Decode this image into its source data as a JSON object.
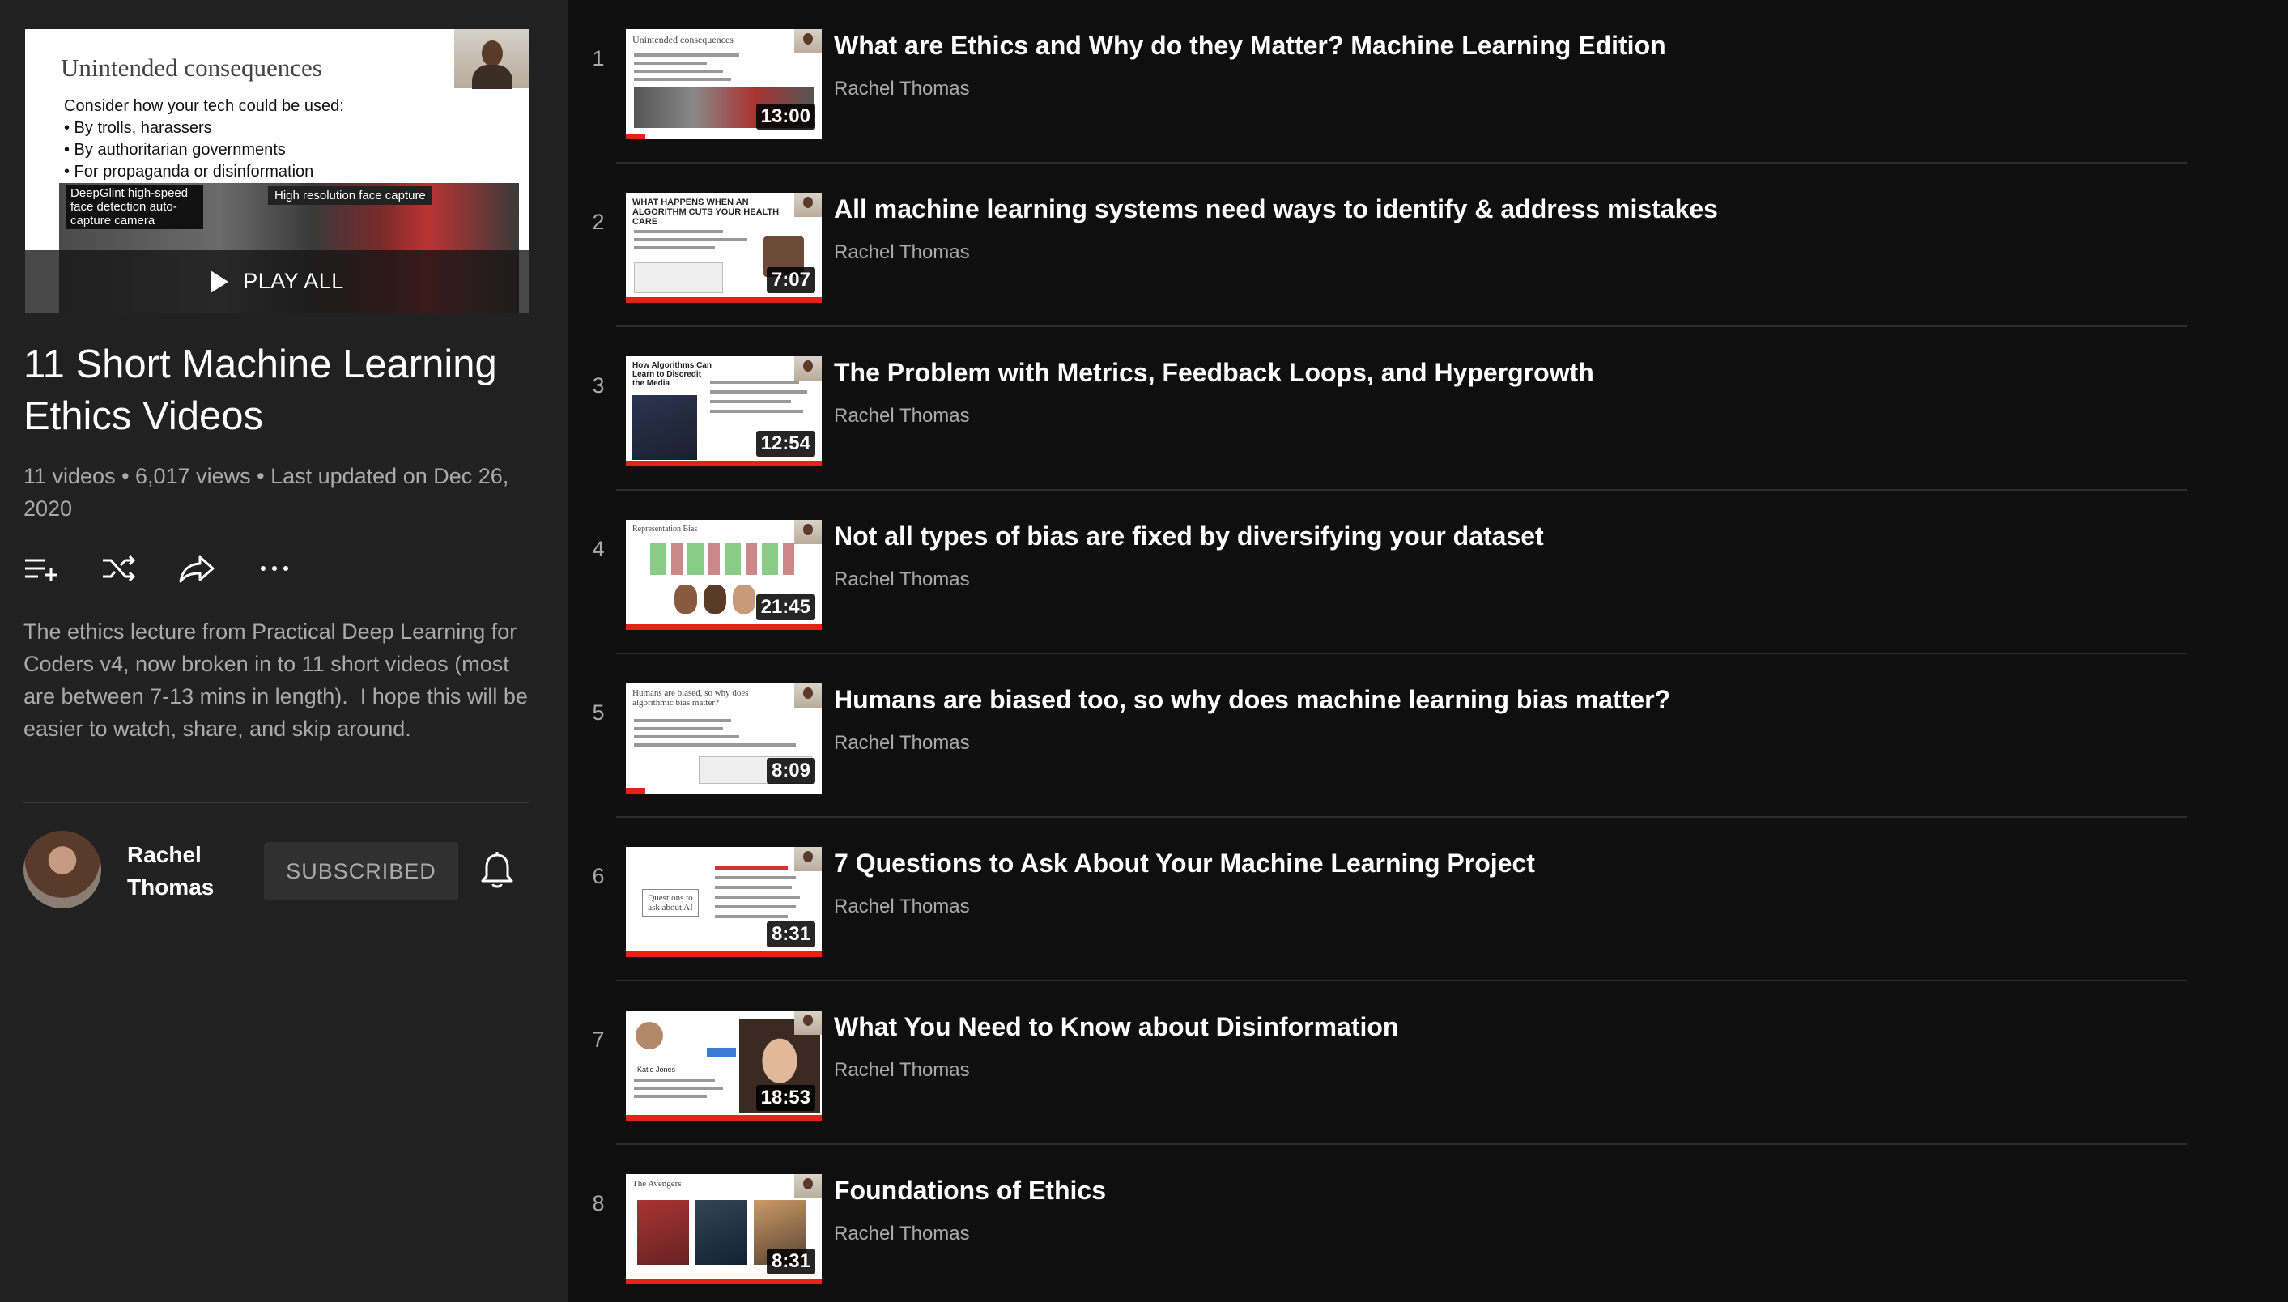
{
  "sidebar": {
    "hero_slide": {
      "title": "Unintended consequences",
      "lines": [
        "Consider how your tech could be used:",
        "• By trolls, harassers",
        "• By authoritarian governments",
        "• For propaganda or disinformation"
      ],
      "caption_left": "DeepGlint high-speed face detection auto-capture camera",
      "caption_right": "High resolution face capture"
    },
    "play_all_label": "PLAY ALL",
    "playlist_title": "11 Short Machine Learning Ethics Videos",
    "stats": "11 videos • 6,017 views • Last updated on Dec 26, 2020",
    "description": "The ethics lecture from Practical Deep Learning for Coders v4, now broken in to 11 short videos (most are between 7-13 mins in length).  I hope this will be easier to watch, share, and skip around.",
    "actions": [
      "add-to-queue-icon",
      "shuffle-icon",
      "share-icon",
      "more-icon"
    ],
    "channel_name": "Rachel Thomas",
    "subscribe_label": "SUBSCRIBED"
  },
  "videos": [
    {
      "index": "1",
      "title": "What are Ethics and Why do they Matter? Machine Learning Edition",
      "author": "Rachel Thomas",
      "duration": "13:00",
      "thumb_text": "Unintended consequences",
      "progress": 0.1
    },
    {
      "index": "2",
      "title": "All machine learning systems need ways to identify & address mistakes",
      "author": "Rachel Thomas",
      "duration": "7:07",
      "thumb_text": "WHAT HAPPENS WHEN AN ALGORITHM CUTS YOUR HEALTH CARE",
      "progress": 1.0
    },
    {
      "index": "3",
      "title": "The Problem with Metrics, Feedback Loops, and Hypergrowth",
      "author": "Rachel Thomas",
      "duration": "12:54",
      "thumb_text": "How Algorithms Can Learn to Discredit the Media",
      "progress": 1.0
    },
    {
      "index": "4",
      "title": "Not all types of bias are fixed by diversifying your dataset",
      "author": "Rachel Thomas",
      "duration": "21:45",
      "thumb_text": "Representation Bias",
      "progress": 1.0
    },
    {
      "index": "5",
      "title": "Humans are biased too, so why does machine learning bias matter?",
      "author": "Rachel Thomas",
      "duration": "8:09",
      "thumb_text": "Humans are biased, so why does algorithmic bias matter?",
      "progress": 0.1
    },
    {
      "index": "6",
      "title": "7 Questions to Ask About Your Machine Learning Project",
      "author": "Rachel Thomas",
      "duration": "8:31",
      "thumb_text": "Questions to ask about AI",
      "progress": 1.0
    },
    {
      "index": "7",
      "title": "What You Need to Know about Disinformation",
      "author": "Rachel Thomas",
      "duration": "18:53",
      "thumb_text": "Katie Jones",
      "progress": 1.0
    },
    {
      "index": "8",
      "title": "Foundations of Ethics",
      "author": "Rachel Thomas",
      "duration": "8:31",
      "thumb_text": "The Avengers",
      "progress": 1.0
    }
  ],
  "colors": {
    "background": "#0f0f0f",
    "sidebar": "#212121",
    "progress": "#e62117",
    "secondary_text": "#aaaaaa"
  }
}
